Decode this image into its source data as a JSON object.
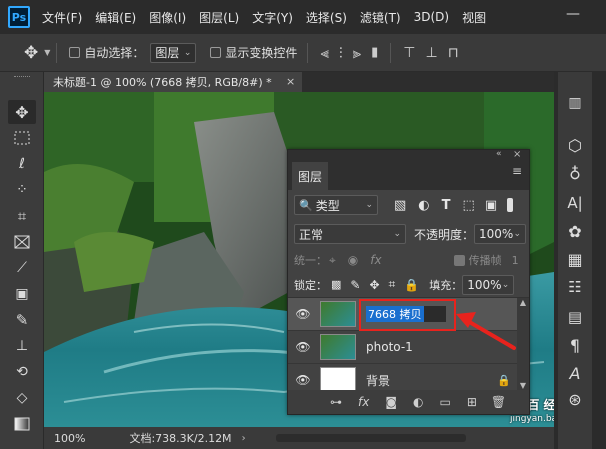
{
  "app": {
    "logo": "Ps"
  },
  "menu": [
    "文件(F)",
    "编辑(E)",
    "图像(I)",
    "图层(L)",
    "文字(Y)",
    "选择(S)",
    "滤镜(T)",
    "3D(D)",
    "视图"
  ],
  "options": {
    "auto_select_label": "自动选择：",
    "auto_select_target": "图层",
    "show_transform_label": "显示变换控件"
  },
  "document": {
    "tab_title": "未标题-1 @ 100% (7668 拷贝, RGB/8#) *",
    "close_glyph": "×",
    "zoom": "100%",
    "doc_info": "文档:738.3K/2.12M"
  },
  "layers_panel": {
    "title": "图层",
    "filter_kind": "类型",
    "blend_mode": "正常",
    "opacity_label": "不透明度：",
    "opacity_value": "100%",
    "unify_label": "统一：",
    "propagate_label": "传播帧",
    "propagate_value": "1",
    "lock_label": "锁定：",
    "fill_label": "填充：",
    "fill_value": "100%",
    "layers": [
      {
        "name": "7668 拷贝",
        "editing": true
      },
      {
        "name": "photo-1",
        "editing": false
      },
      {
        "name": "背景",
        "editing": false,
        "locked": true
      }
    ],
    "footer_fx": "fx"
  },
  "watermark": {
    "text": "Bai百 经验",
    "url": "jingyan.baidu.com"
  },
  "colors": {
    "accent": "#31a8ff",
    "highlight": "#e8231d",
    "selection": "#1a6fcf"
  }
}
